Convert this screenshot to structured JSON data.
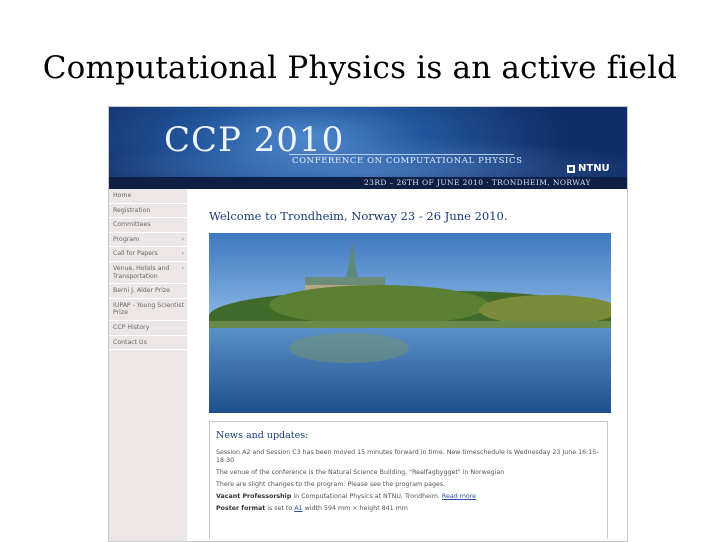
{
  "slide": {
    "title": "Computational Physics is an active field"
  },
  "banner": {
    "title": "CCP 2010",
    "subtitle": "CONFERENCE ON COMPUTATIONAL PHYSICS",
    "logo": "NTNU",
    "dates": "23RD – 26TH OF JUNE 2010 · TRONDHEIM, NORWAY"
  },
  "sidebar": {
    "items": [
      {
        "label": "Home",
        "submenu": false
      },
      {
        "label": "Registration",
        "submenu": false
      },
      {
        "label": "Committees",
        "submenu": false
      },
      {
        "label": "Program",
        "submenu": true
      },
      {
        "label": "Call for Papers",
        "submenu": true
      },
      {
        "label": "Venue, Hotels and Transportation",
        "submenu": true
      },
      {
        "label": "Berni J. Alder Prize",
        "submenu": false
      },
      {
        "label": "IUPAP - Young Scientist Prize",
        "submenu": false
      },
      {
        "label": "CCP History",
        "submenu": false
      },
      {
        "label": "Contact Us",
        "submenu": false
      }
    ],
    "submenu_glyph": "›"
  },
  "main": {
    "welcome": "Welcome to Trondheim, Norway 23 - 26 June 2010.",
    "news": {
      "title": "News and updates:",
      "line1": "Session A2 and Session C3 has been moved 15 minutes forward in time. New timeschedule is Wednesday 23 June 16:15–18:30",
      "line2": "The venue of the conference is the Natural Science Building, \"Realfagbygget\" in Norwegian",
      "line3": "There are slight changes to the program. Please see the program pages.",
      "line4_bold": "Vacant Professorship",
      "line4_rest": " in Computational Physics at NTNU, Trondheim. ",
      "line4_link": "Read more",
      "line5_bold": "Poster format",
      "line5_mid": " is set to ",
      "line5_link": "A1",
      "line5_rest": " width 594 mm × height 841 mm"
    }
  },
  "colors": {
    "accent": "#173b7a",
    "banner": "#22559c",
    "sidebar_bg": "#ece6e6"
  }
}
